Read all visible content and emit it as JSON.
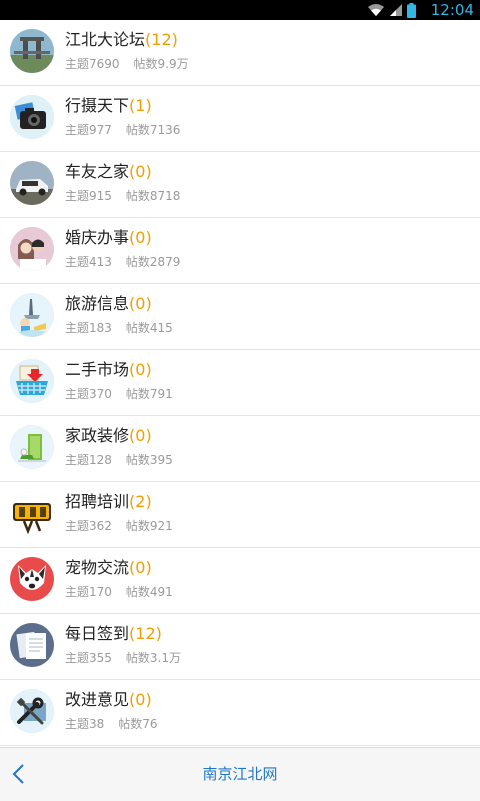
{
  "status_bar": {
    "time": "12:04"
  },
  "forums": [
    {
      "name": "江北大论坛",
      "count": "(12)",
      "topics": "主题7690",
      "posts": "帖数9.9万",
      "icon": "bridge-photo-icon"
    },
    {
      "name": "行摄天下",
      "count": "(1)",
      "topics": "主题977",
      "posts": "帖数7136",
      "icon": "camera-icon"
    },
    {
      "name": "车友之家",
      "count": "(0)",
      "topics": "主题915",
      "posts": "帖数8718",
      "icon": "car-icon"
    },
    {
      "name": "婚庆办事",
      "count": "(0)",
      "topics": "主题413",
      "posts": "帖数2879",
      "icon": "wedding-couple-icon"
    },
    {
      "name": "旅游信息",
      "count": "(0)",
      "topics": "主题183",
      "posts": "帖数415",
      "icon": "travel-icon"
    },
    {
      "name": "二手市场",
      "count": "(0)",
      "topics": "主题370",
      "posts": "帖数791",
      "icon": "shopping-basket-icon"
    },
    {
      "name": "家政装修",
      "count": "(0)",
      "topics": "主题128",
      "posts": "帖数395",
      "icon": "decoration-icon"
    },
    {
      "name": "招聘培训",
      "count": "(2)",
      "topics": "主题362",
      "posts": "帖数921",
      "icon": "recruit-sign-icon"
    },
    {
      "name": "宠物交流",
      "count": "(0)",
      "topics": "主题170",
      "posts": "帖数491",
      "icon": "dog-icon"
    },
    {
      "name": "每日签到",
      "count": "(12)",
      "topics": "主题355",
      "posts": "帖数3.1万",
      "icon": "papers-icon"
    },
    {
      "name": "改进意见",
      "count": "(0)",
      "topics": "主题38",
      "posts": "帖数76",
      "icon": "tools-icon"
    }
  ],
  "bottom_bar": {
    "title": "南京江北网",
    "back_icon": "chevron-left-icon"
  },
  "colors": {
    "accent": "#1f78c9",
    "count": "#f0a000",
    "status": "#33b5e5"
  }
}
